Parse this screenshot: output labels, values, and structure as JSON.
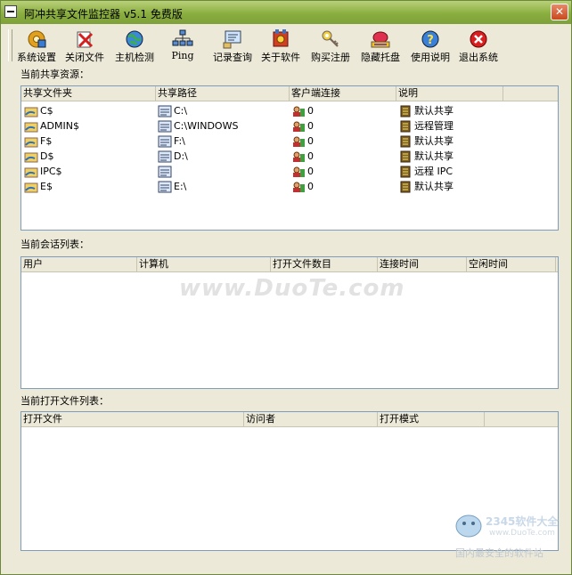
{
  "window": {
    "title": "阿冲共享文件监控器 v5.1 免费版",
    "close_glyph": "✕"
  },
  "toolbar": {
    "items": [
      {
        "label": "系统设置",
        "icon": "settings-icon"
      },
      {
        "label": "关闭文件",
        "icon": "close-file-icon"
      },
      {
        "label": "主机检测",
        "icon": "globe-icon"
      },
      {
        "label": "Ping",
        "icon": "network-icon"
      },
      {
        "label": "记录查询",
        "icon": "log-icon"
      },
      {
        "label": "关于软件",
        "icon": "about-icon"
      },
      {
        "label": "购买注册",
        "icon": "key-icon"
      },
      {
        "label": "隐藏托盘",
        "icon": "tray-icon"
      },
      {
        "label": "使用说明",
        "icon": "help-icon"
      },
      {
        "label": "退出系统",
        "icon": "exit-icon"
      }
    ]
  },
  "shares": {
    "label": "当前共享资源：",
    "columns": [
      "共享文件夹",
      "共享路径",
      "客户端连接",
      "说明"
    ],
    "rows": [
      {
        "name": "C$",
        "path": "C:\\",
        "clients": "0",
        "desc": "默认共享"
      },
      {
        "name": "ADMIN$",
        "path": "C:\\WINDOWS",
        "clients": "0",
        "desc": "远程管理"
      },
      {
        "name": "F$",
        "path": "F:\\",
        "clients": "0",
        "desc": "默认共享"
      },
      {
        "name": "D$",
        "path": "D:\\",
        "clients": "0",
        "desc": "默认共享"
      },
      {
        "name": "IPC$",
        "path": "",
        "clients": "0",
        "desc": "远程 IPC"
      },
      {
        "name": "E$",
        "path": "E:\\",
        "clients": "0",
        "desc": "默认共享"
      }
    ]
  },
  "sessions": {
    "label": "当前会话列表：",
    "columns": [
      "用户",
      "计算机",
      "打开文件数目",
      "连接时间",
      "空闲时间"
    ]
  },
  "openfiles": {
    "label": "当前打开文件列表：",
    "columns": [
      "打开文件",
      "访问者",
      "打开模式"
    ]
  },
  "watermark": {
    "text": "www.DuoTe.com"
  },
  "corner": {
    "brand": "2345软件大全",
    "url": "www.DuoTe.com",
    "slogan": "国内最安全的软件站"
  },
  "colors": {
    "titlebar": "#8aae3f",
    "window_bg": "#ece9d8",
    "panel_border": "#7f9db9",
    "close": "#c9481e"
  }
}
